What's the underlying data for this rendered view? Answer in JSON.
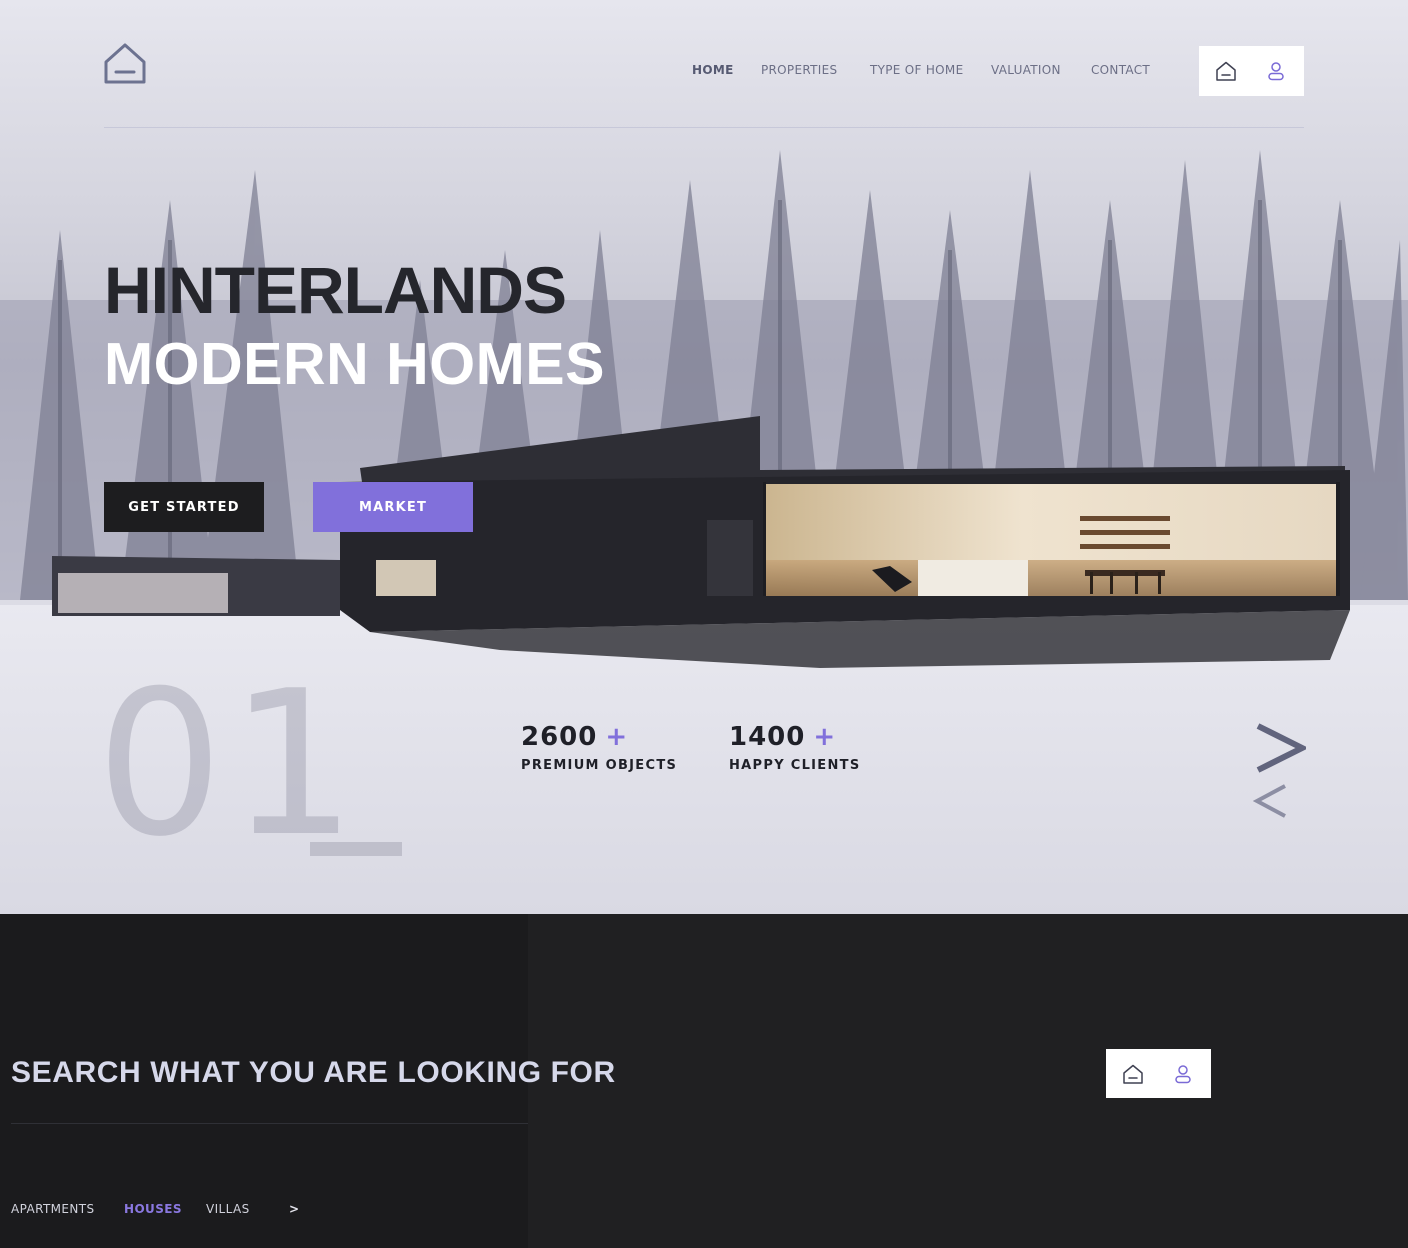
{
  "nav": {
    "items": [
      "HOME",
      "PROPERTIES",
      "TYPE OF HOME",
      "VALUATION",
      "CONTACT"
    ],
    "active_index": 0
  },
  "header_icons": [
    "home-icon",
    "user-icon"
  ],
  "hero": {
    "title_line_1": "HINTERLANDS",
    "title_line_2": "MODERN HOMES",
    "buttons": {
      "primary": "GET STARTED",
      "secondary": "MARKET"
    },
    "slide_number": "01",
    "stats": [
      {
        "value": "2600",
        "plus": "+",
        "label": "PREMIUM OBJECTS"
      },
      {
        "value": "1400",
        "plus": "+",
        "label": "HAPPY CLIENTS"
      }
    ],
    "arrows": {
      "next": ">",
      "prev": "<"
    }
  },
  "search": {
    "title": "SEARCH WHAT YOU ARE LOOKING FOR",
    "categories": [
      "APARTMENTS",
      "HOUSES",
      "VILLAS"
    ],
    "active_category_index": 1,
    "next_label": ">"
  },
  "colors": {
    "accent": "#8170db",
    "dark": "#1d1d1f",
    "bottom_bg": "#202022"
  }
}
